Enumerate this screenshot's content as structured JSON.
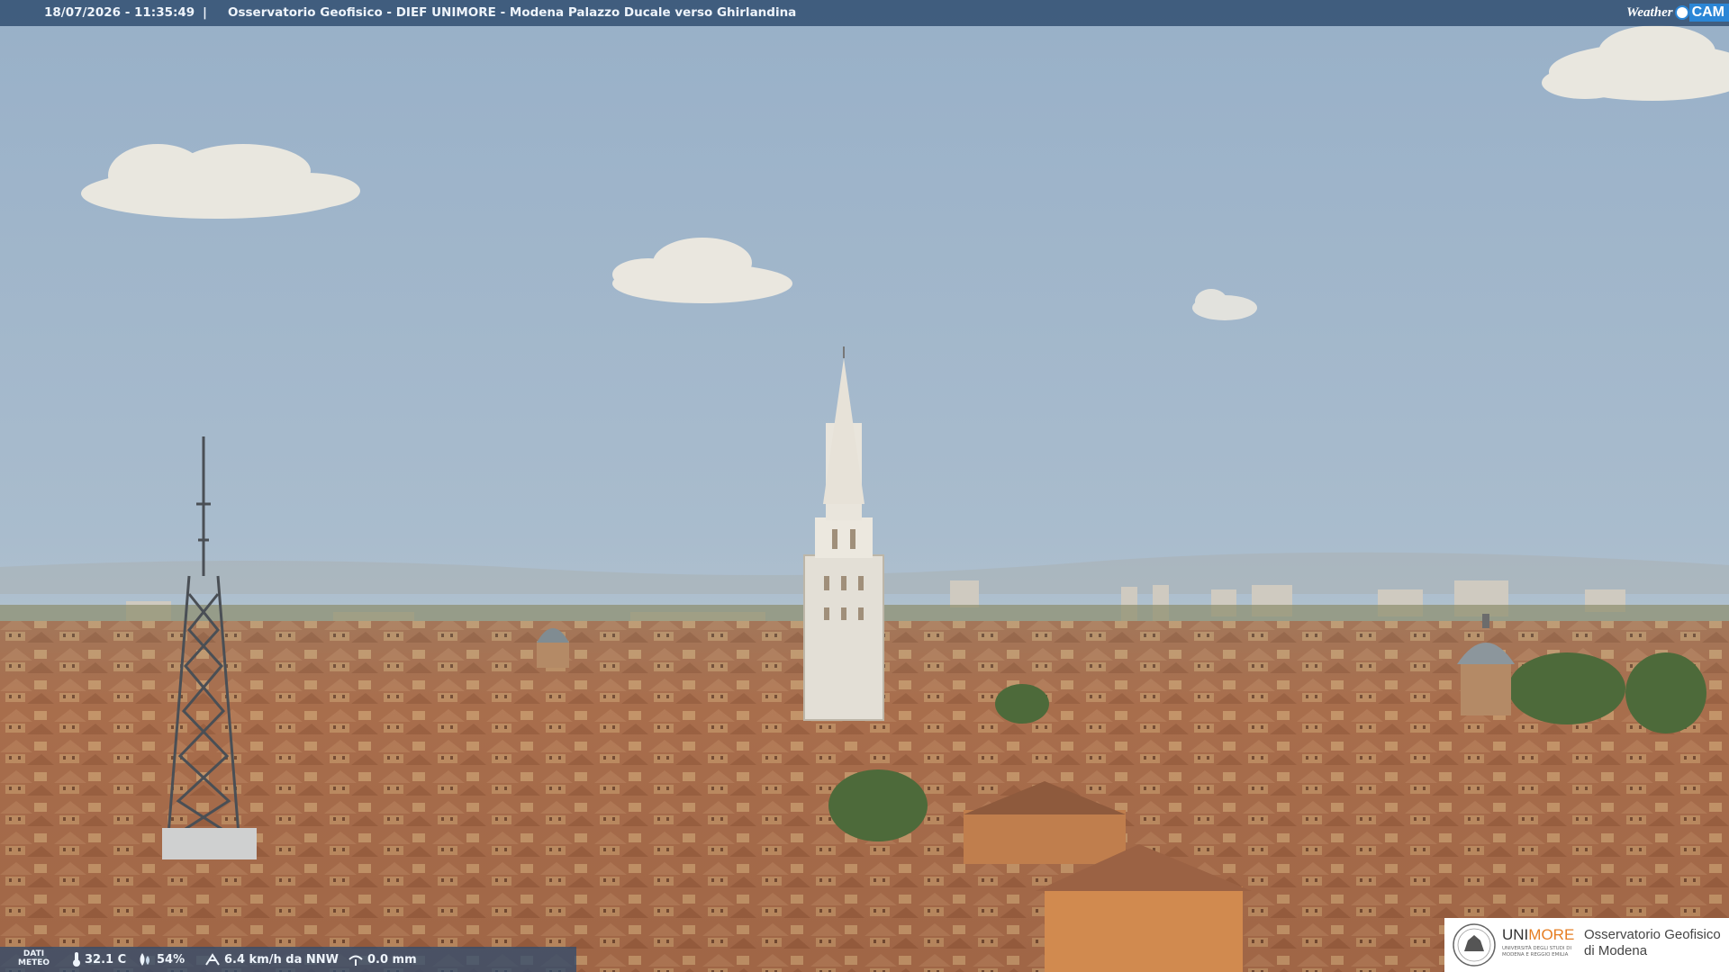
{
  "overlay": {
    "datetime": "18/07/2026 - 11:35:49",
    "separator": "|",
    "title": "Osservatorio Geofisico - DIEF UNIMORE - Modena Palazzo Ducale verso Ghirlandina",
    "logo": {
      "weather": "Weather",
      "cam": "CAM",
      "icon": "camera-eye-icon"
    }
  },
  "meteo": {
    "label_line1": "DATI",
    "label_line2": "METEO",
    "temperature": "32.1 C",
    "humidity": "54%",
    "wind": "6.4 km/h da NNW",
    "rain": "0.0 mm",
    "icons": [
      "thermometer-icon",
      "humidity-drop-icon",
      "wind-icon",
      "rain-gauge-icon"
    ]
  },
  "branding": {
    "uni_prefix": "UNI",
    "uni_suffix": "MORE",
    "uni_subtitle": "UNIVERSITÀ DEGLI STUDI DI MODENA E REGGIO EMILIA",
    "observatory_line1": "Osservatorio Geofisico",
    "observatory_line2": "di Modena"
  },
  "colors": {
    "sky_top": "#98b0c8",
    "sky_horizon": "#c7cfd2",
    "roof": "#b27554",
    "tower": "#e4dfd4",
    "overlay_bar": "#2d4b6e"
  }
}
